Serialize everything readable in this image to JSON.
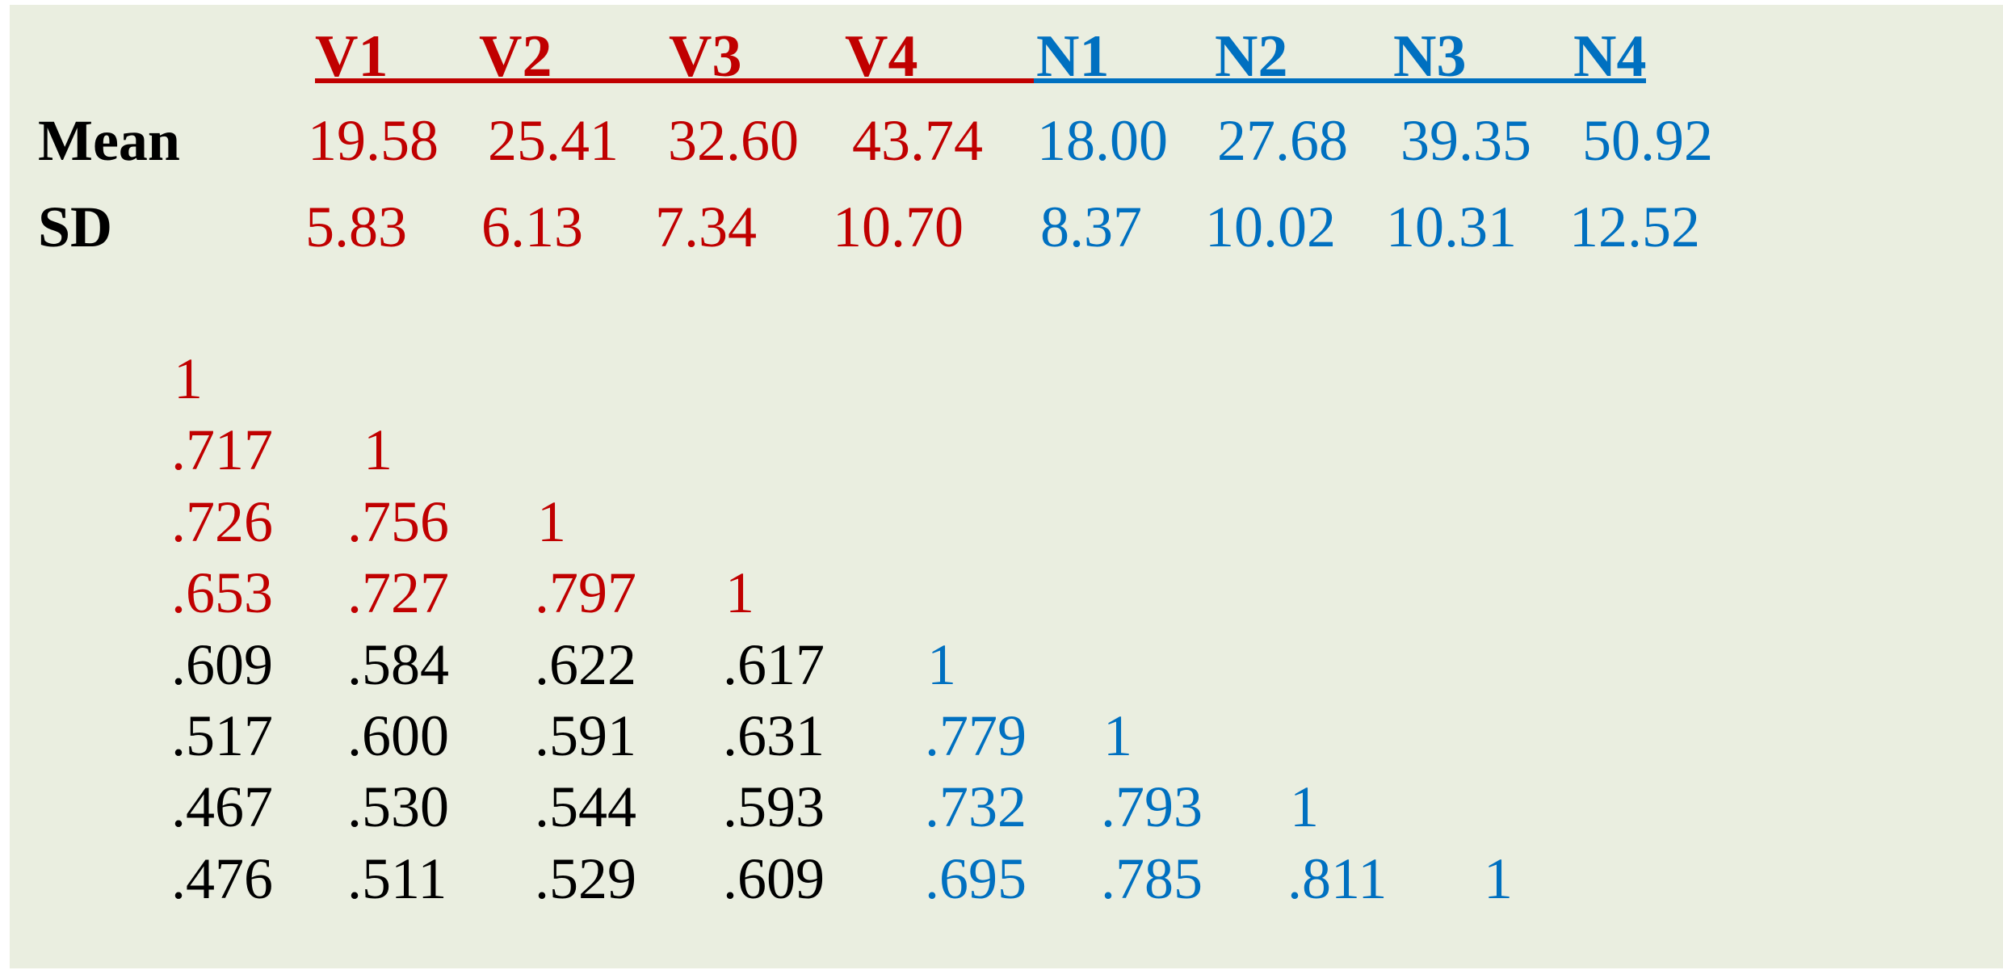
{
  "colors": {
    "v_group": "#C00000",
    "n_group": "#0070C0",
    "cross": "#000000",
    "background": "#EAEEE0"
  },
  "header": {
    "v_labels": [
      "V1",
      "V2",
      "V3",
      "V4"
    ],
    "n_labels": [
      "N1",
      "N2",
      "N3",
      "N4"
    ]
  },
  "stats": {
    "mean_label": "Mean",
    "sd_label": "SD",
    "mean": {
      "v": [
        "19.58",
        "25.41",
        "32.60",
        "43.74"
      ],
      "n": [
        "18.00",
        "27.68",
        "39.35",
        "50.92"
      ]
    },
    "sd": {
      "v": [
        "5.83",
        "6.13",
        "7.34",
        "10.70"
      ],
      "n": [
        "8.37",
        "10.02",
        "10.31",
        "12.52"
      ]
    }
  },
  "correlation_matrix": {
    "variables": [
      "V1",
      "V2",
      "V3",
      "V4",
      "N1",
      "N2",
      "N3",
      "N4"
    ],
    "rows": [
      [
        "1"
      ],
      [
        ".717",
        "1"
      ],
      [
        ".726",
        ".756",
        "1"
      ],
      [
        ".653",
        ".727",
        ".797",
        "1"
      ],
      [
        ".609",
        ".584",
        ".622",
        ".617",
        "1"
      ],
      [
        ".517",
        ".600",
        ".591",
        ".631",
        ".779",
        "1"
      ],
      [
        ".467",
        ".530",
        ".544",
        ".593",
        ".732",
        ".793",
        "1"
      ],
      [
        ".476",
        ".511",
        ".529",
        ".609",
        ".695",
        ".785",
        ".811",
        "1"
      ]
    ]
  }
}
